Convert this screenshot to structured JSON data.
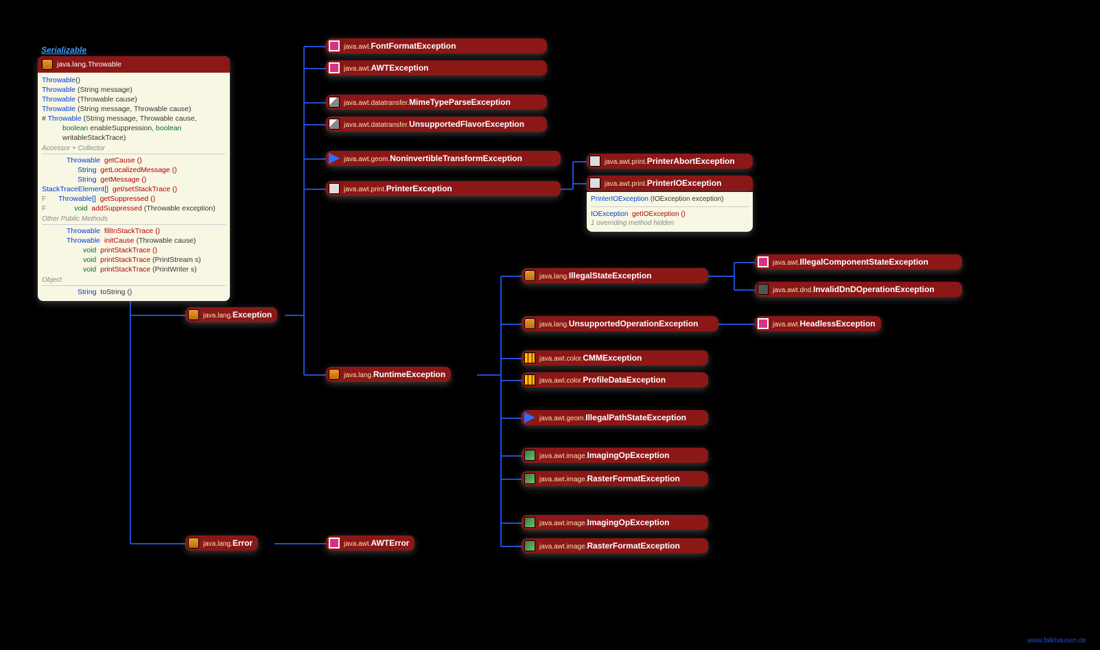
{
  "serializable": "Serializable",
  "throwable": {
    "pkg": "java.lang.",
    "name": "Throwable",
    "constructors": [
      {
        "sig": "Throwable",
        "args": "()"
      },
      {
        "sig": "Throwable",
        "args": " (String message)"
      },
      {
        "sig": "Throwable",
        "args": " (Throwable cause)"
      },
      {
        "sig": "Throwable",
        "args": " (String message, Throwable cause)"
      },
      {
        "mod": "#",
        "sig": "Throwable",
        "args": " (String message, Throwable cause,"
      },
      {
        "cont": "boolean enableSuppression, boolean writableStackTrace)"
      }
    ],
    "sec1": "Accessor + Collector",
    "acc": [
      {
        "ret": "Throwable",
        "m": "getCause ()"
      },
      {
        "ret": "String",
        "m": "getLocalizedMessage ()"
      },
      {
        "ret": "String",
        "m": "getMessage ()"
      },
      {
        "ret": "StackTraceElement[]",
        "m": "get/setStackTrace ()"
      },
      {
        "mod": "F",
        "ret": "Throwable[]",
        "m": "getSuppressed ()"
      },
      {
        "mod": "F",
        "ret": "void",
        "m": "addSuppressed",
        "args": " (Throwable exception)"
      }
    ],
    "sec2": "Other Public Methods",
    "pub": [
      {
        "ret": "Throwable",
        "m": "fillInStackTrace ()"
      },
      {
        "ret": "Throwable",
        "m": "initCause",
        "args": " (Throwable cause)"
      },
      {
        "ret": "void",
        "m": "printStackTrace ()"
      },
      {
        "ret": "void",
        "m": "printStackTrace",
        "args": " (PrintStream s)"
      },
      {
        "ret": "void",
        "m": "printStackTrace",
        "args": " (PrintWriter s)"
      }
    ],
    "sec3": "Object",
    "obj": [
      {
        "ret": "String",
        "m": "toString ()"
      }
    ]
  },
  "nodes": {
    "exception": {
      "pkg": "java.lang.",
      "name": "Exception",
      "icon": "cup"
    },
    "error": {
      "pkg": "java.lang.",
      "name": "Error",
      "icon": "cup"
    },
    "awterror": {
      "pkg": "java.awt.",
      "name": "AWTError",
      "icon": "squarepink"
    },
    "fontformat": {
      "pkg": "java.awt.",
      "name": "FontFormatException",
      "icon": "squarepink"
    },
    "awtexc": {
      "pkg": "java.awt.",
      "name": "AWTException",
      "icon": "squarepink"
    },
    "mimetype": {
      "pkg": "java.awt.datatransfer.",
      "name": "MimeTypeParseException",
      "icon": "pen"
    },
    "unsupflavor": {
      "pkg": "java.awt.datatransfer.",
      "name": "UnsupportedFlavorException",
      "icon": "pen"
    },
    "noninv": {
      "pkg": "java.awt.geom.",
      "name": "NoninvertibleTransformException",
      "icon": "tri"
    },
    "printerexc": {
      "pkg": "java.awt.print.",
      "name": "PrinterException",
      "icon": "printer"
    },
    "printerabort": {
      "pkg": "java.awt.print.",
      "name": "PrinterAbortException",
      "icon": "printer"
    },
    "printerio": {
      "pkg": "java.awt.print.",
      "name": "PrinterIOException",
      "icon": "printer"
    },
    "runtime": {
      "pkg": "java.lang.",
      "name": "RuntimeException",
      "icon": "cup"
    },
    "illstate": {
      "pkg": "java.lang.",
      "name": "IllegalStateException",
      "icon": "cup"
    },
    "illcomp": {
      "pkg": "java.awt.",
      "name": "IllegalComponentStateException",
      "icon": "squarepink"
    },
    "invdnd": {
      "pkg": "java.awt.dnd.",
      "name": "InvalidDnDOperationException",
      "icon": "dnd"
    },
    "unsupop": {
      "pkg": "java.lang.",
      "name": "UnsupportedOperationException",
      "icon": "cup"
    },
    "headless": {
      "pkg": "java.awt.",
      "name": "HeadlessException",
      "icon": "squarepink"
    },
    "cmm": {
      "pkg": "java.awt.color.",
      "name": "CMMException",
      "icon": "bars"
    },
    "profile": {
      "pkg": "java.awt.color.",
      "name": "ProfileDataException",
      "icon": "bars"
    },
    "illpath": {
      "pkg": "java.awt.geom.",
      "name": "IllegalPathStateException",
      "icon": "tri"
    },
    "imgop1": {
      "pkg": "java.awt.image.",
      "name": "ImagingOpException",
      "icon": "imgicon"
    },
    "raster1": {
      "pkg": "java.awt.image.",
      "name": "RasterFormatException",
      "icon": "imgicon"
    },
    "imgop2": {
      "pkg": "java.awt.image.",
      "name": "ImagingOpException",
      "icon": "imgicon"
    },
    "raster2": {
      "pkg": "java.awt.image.",
      "name": "RasterFormatException",
      "icon": "imgicon"
    }
  },
  "printerio_detail": {
    "ctor": {
      "name": "PrinterIOException",
      "args": " (IOException exception)"
    },
    "method": {
      "ret": "IOException",
      "m": "getIOException ()"
    },
    "note": "1 overriding method hidden"
  },
  "watermark": "www.falkhausen.de"
}
